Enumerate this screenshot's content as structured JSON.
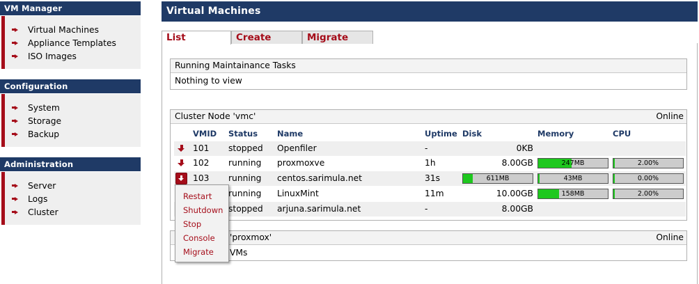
{
  "sidebar": {
    "sections": [
      {
        "title": "VM Manager",
        "items": [
          "Virtual Machines",
          "Appliance Templates",
          "ISO Images"
        ]
      },
      {
        "title": "Configuration",
        "items": [
          "System",
          "Storage",
          "Backup"
        ]
      },
      {
        "title": "Administration",
        "items": [
          "Server",
          "Logs",
          "Cluster"
        ]
      }
    ]
  },
  "main": {
    "title": "Virtual Machines",
    "tabs": [
      "List",
      "Create",
      "Migrate"
    ],
    "active_tab": "List"
  },
  "tasks_panel": {
    "title": "Running Maintainance Tasks",
    "body": "Nothing to view"
  },
  "cluster_node_1": {
    "title": "Cluster Node 'vmc'",
    "status": "Online",
    "columns": [
      "VMID",
      "Status",
      "Name",
      "Uptime",
      "Disk",
      "Memory",
      "CPU"
    ],
    "rows": [
      {
        "vmid": "101",
        "status": "stopped",
        "name": "Openfiler",
        "uptime": "-",
        "disk": "0KB",
        "disk_bar": null,
        "memory": null,
        "memory_level": null,
        "cpu": null,
        "cpu_level": null
      },
      {
        "vmid": "102",
        "status": "running",
        "name": "proxmoxve",
        "uptime": "1h",
        "disk": "8.00GB",
        "disk_bar": null,
        "memory": "247MB",
        "memory_level": 0.48,
        "cpu": "2.00%",
        "cpu_level": 0.02
      },
      {
        "vmid": "103",
        "status": "running",
        "name": "centos.sarimula.net",
        "uptime": "31s",
        "disk": null,
        "disk_bar": "611MB",
        "disk_level": 0.14,
        "memory": "43MB",
        "memory_level": 0.0,
        "cpu": "0.00%",
        "cpu_level": 0.0
      },
      {
        "vmid": "",
        "status": "running",
        "name": "LinuxMint",
        "uptime": "11m",
        "disk": "10.00GB",
        "disk_bar": null,
        "memory": "158MB",
        "memory_level": 0.3,
        "cpu": "2.00%",
        "cpu_level": 0.02
      },
      {
        "vmid": "",
        "status": "stopped",
        "name": "arjuna.sarimula.net",
        "uptime": "-",
        "disk": "8.00GB",
        "disk_bar": null,
        "memory": null,
        "memory_level": null,
        "cpu": null,
        "cpu_level": null
      }
    ]
  },
  "cluster_node_2": {
    "title_visible": "'proxmox'",
    "status": "Online",
    "body_visible": "VMs"
  },
  "context_menu": {
    "items": [
      "Restart",
      "Shutdown",
      "Stop",
      "Console",
      "Migrate"
    ]
  },
  "colors": {
    "header_bg": "#1f3a66",
    "accent_red": "#a50d1a",
    "bar_green": "#1ec81e"
  }
}
